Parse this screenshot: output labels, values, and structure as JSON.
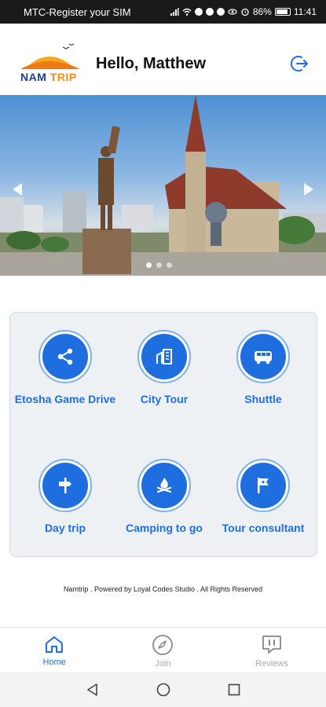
{
  "status_bar": {
    "carrier": "MTC-Register your SIM",
    "battery": "86%",
    "time": "11:41"
  },
  "header": {
    "logo_nam": "NAM",
    "logo_trip": "TRIP",
    "greeting": "Hello, Matthew",
    "logout_icon": "logout-icon"
  },
  "banner": {
    "slide_count": 3,
    "active_slide": 1
  },
  "services": [
    {
      "label": "Etosha Game Drive",
      "icon": "share-nodes-icon"
    },
    {
      "label": "City Tour",
      "icon": "buildings-icon"
    },
    {
      "label": "Shuttle",
      "icon": "bus-icon"
    },
    {
      "label": "Day trip",
      "icon": "signpost-icon"
    },
    {
      "label": "Camping to go",
      "icon": "campfire-icon"
    },
    {
      "label": "Tour consultant",
      "icon": "flag-icon"
    }
  ],
  "footer": {
    "text": "Namtrip . Powered by Loyal Codes Studio . All Rights Reserved"
  },
  "bottom_nav": [
    {
      "label": "Home",
      "icon": "home-icon",
      "active": true
    },
    {
      "label": "Join",
      "icon": "compass-icon",
      "active": false
    },
    {
      "label": "Reviews",
      "icon": "review-icon",
      "active": false
    }
  ],
  "colors": {
    "accent": "#1f6ee0",
    "inactive": "#aaaaaa",
    "logo_blue": "#1f3f8a",
    "logo_orange": "#f28c1a"
  }
}
